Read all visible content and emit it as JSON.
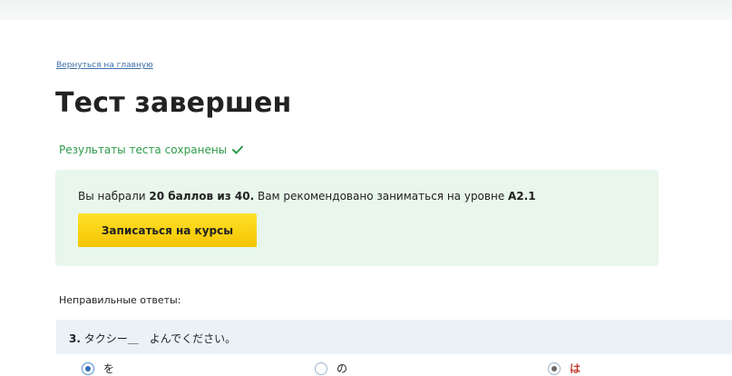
{
  "back_link": "Вернуться на главную",
  "page_title": "Тест завершен",
  "saved_text": "Результаты теста сохранены",
  "result": {
    "prefix": "Вы набрали ",
    "score": "20 баллов из 40.",
    "middle": " Вам рекомендовано заниматься на уровне ",
    "level": "A2.1",
    "button_label": "Записаться на курсы"
  },
  "wrong_answers_title": "Неправильные ответы:",
  "question": {
    "number": "3.",
    "text": " タクシー＿　よんでください。",
    "options": [
      {
        "label": "を",
        "state": "correct-selected"
      },
      {
        "label": "の",
        "state": "unselected"
      },
      {
        "label": "は",
        "state": "user-wrong"
      }
    ]
  },
  "colors": {
    "success_green": "#2e9a4a",
    "result_box_bg": "#e8f6ec",
    "button_yellow": "#f4c400",
    "question_bg": "#eaf2f8",
    "wrong_red": "#c0392b",
    "link_blue": "#3b6fa8"
  }
}
